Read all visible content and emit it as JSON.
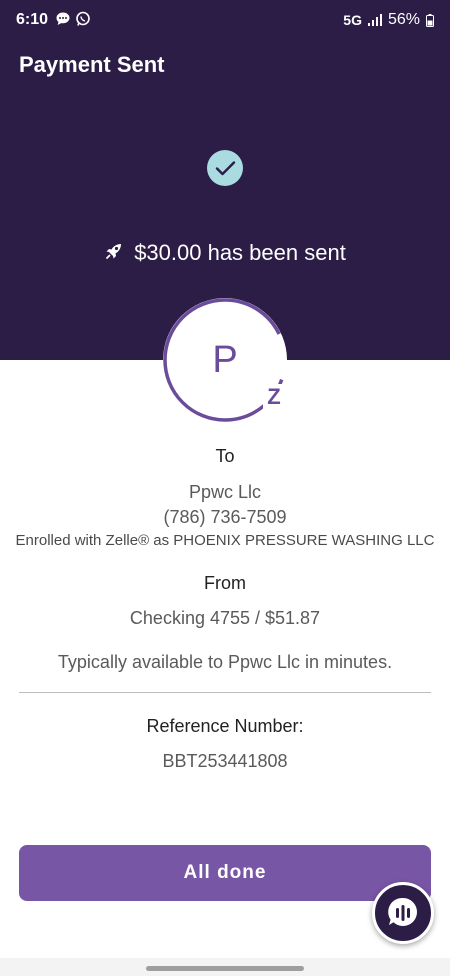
{
  "status_bar": {
    "time": "6:10",
    "network": "5G",
    "battery": "56%"
  },
  "header": {
    "title": "Payment Sent"
  },
  "confirmation": {
    "amount_text": "$30.00 has been sent",
    "icon": "check-icon"
  },
  "recipient": {
    "avatar_letter": "P",
    "to_label": "To",
    "name": "Ppwc Llc",
    "phone": "(786) 736-7509",
    "enrolled_text": "Enrolled with Zelle® as PHOENIX PRESSURE WASHING LLC"
  },
  "sender": {
    "from_label": "From",
    "account": "Checking 4755 / $51.87",
    "availability": "Typically available to Ppwc Llc in minutes."
  },
  "reference": {
    "label": "Reference Number:",
    "number": "BBT253441808"
  },
  "actions": {
    "done_label": "All done"
  },
  "colors": {
    "hero_bg": "#2c1d47",
    "accent": "#7856a6",
    "check_bg": "#a9dbe0"
  }
}
